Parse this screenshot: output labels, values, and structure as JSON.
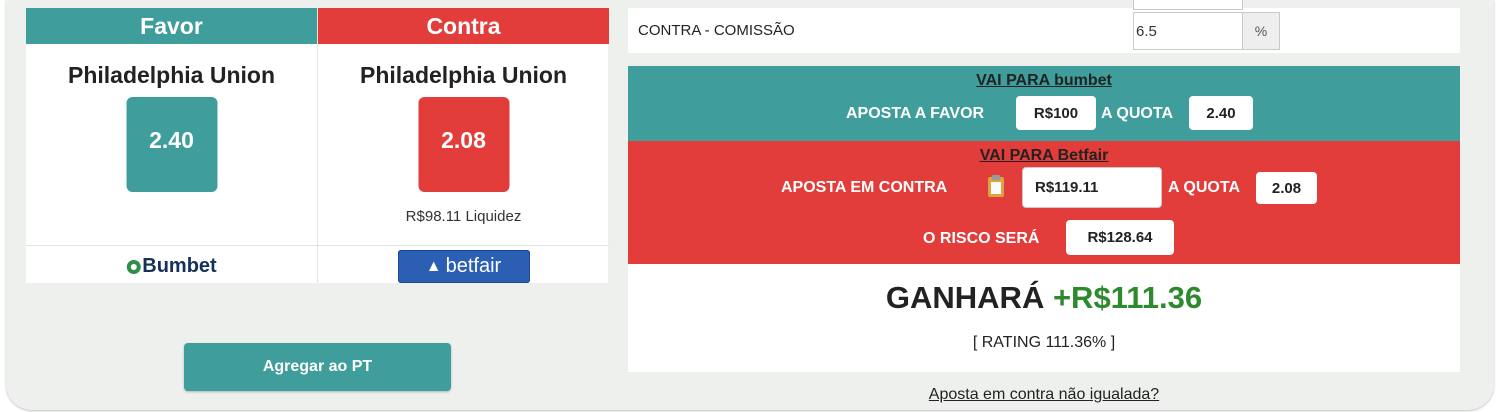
{
  "left": {
    "favor": {
      "header": "Favor",
      "team": "Philadelphia Union",
      "odds": "2.40",
      "bookmaker": "Bumbet"
    },
    "contra": {
      "header": "Contra",
      "team": "Philadelphia Union",
      "odds": "2.08",
      "liquidity": "R$98.11 Liquidez",
      "exchange": "betfair"
    },
    "add_button": "Agregar ao PT"
  },
  "commission": {
    "label": "CONTRA - COMISSÃO",
    "value": "6.5",
    "unit": "%"
  },
  "favor_panel": {
    "title": "VAI PARA bumbet",
    "stake_label": "APOSTA A FAVOR",
    "stake": "R$100",
    "odds_label": "A QUOTA",
    "odds": "2.40"
  },
  "contra_panel": {
    "title": "VAI PARA Betfair",
    "stake_label": "APOSTA EM CONTRA",
    "stake": "R$119.11",
    "odds_label": "A QUOTA",
    "odds": "2.08",
    "risk_label": "O RISCO SERÁ",
    "risk": "R$128.64"
  },
  "result": {
    "label": "GANHARÁ",
    "amount": "+R$111.36",
    "rating": "[ RATING 111.36% ]"
  },
  "unmatched_link": "Aposta em contra não igualada?",
  "colors": {
    "teal": "#3f9e9b",
    "red": "#e33d3b",
    "profit_green": "#2f8a2f"
  },
  "icons": {
    "bumbet_logo": "bumbet-logo",
    "betfair_logo": "betfair-logo",
    "copy": "clipboard-icon"
  }
}
